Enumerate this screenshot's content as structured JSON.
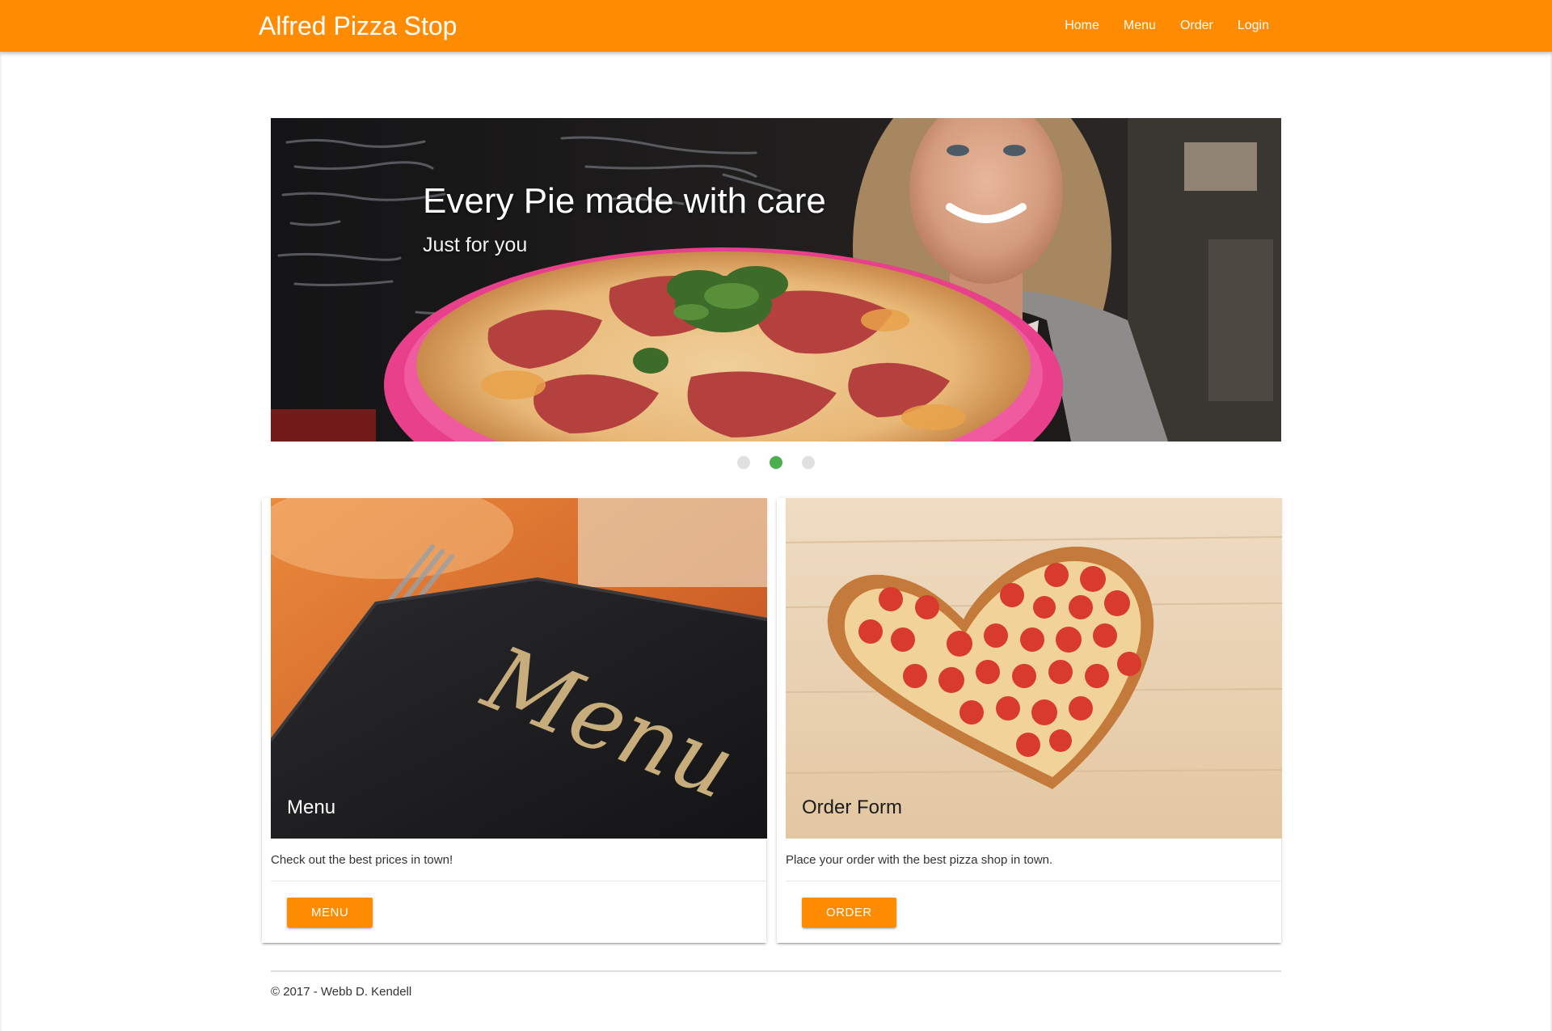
{
  "header": {
    "brand": "Alfred Pizza Stop",
    "nav": [
      "Home",
      "Menu",
      "Order",
      "Login"
    ]
  },
  "slider": {
    "title": "Every Pie made with care",
    "subtitle": "Just for you",
    "active_index": 1,
    "slide_count": 3
  },
  "cards": [
    {
      "title": "Menu",
      "text": "Check out the best prices in town!",
      "button": "MENU"
    },
    {
      "title": "Order Form",
      "text": "Place your order with the best pizza shop in town.",
      "button": "ORDER"
    }
  ],
  "footer": {
    "text": "© 2017 - Webb D. Kendell"
  },
  "colors": {
    "brand": "#ff8c00",
    "indicator_active": "#4caf50",
    "indicator_inactive": "#e0e0e0"
  }
}
